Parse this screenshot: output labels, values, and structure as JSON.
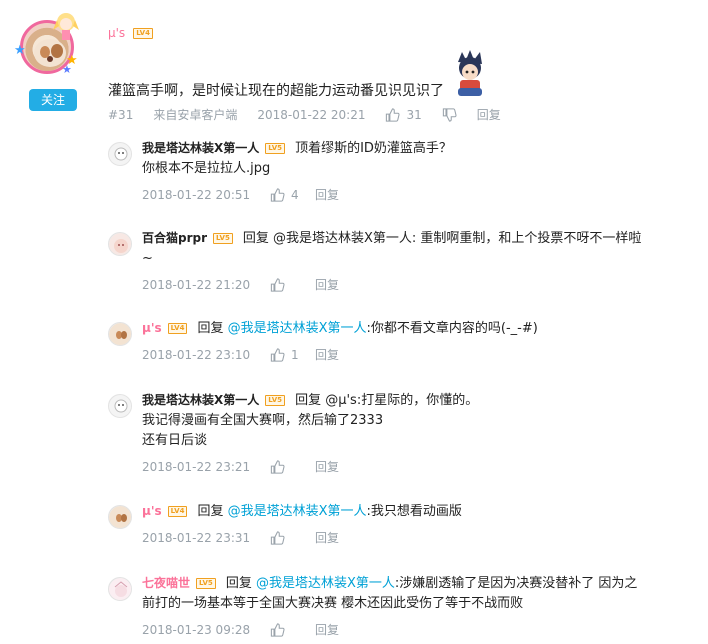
{
  "main": {
    "username": "μ's",
    "level": "LV4",
    "follow_label": "关注",
    "text": "灌篮高手啊，是时候让现在的超能力运动番见识见识了",
    "floor": "#31",
    "client": "来自安卓客户端",
    "time": "2018-01-22 20:21",
    "likes": "31",
    "reply_label": "回复"
  },
  "replies": [
    {
      "name": "我是塔达林装X第一人",
      "level": "LV5",
      "lines": [
        "顶着缪斯的ID奶灌篮高手？",
        "你根本不是拉拉人.jpg"
      ],
      "time": "2018-01-22 20:51",
      "likes": "4",
      "reply_label": "回复"
    },
    {
      "name": "百合猫prpr",
      "level": "LV5",
      "prefix": "回复 @我是塔达林装X第一人: 重制啊重制，和上个投票不呀不一样啦",
      "line2": "~",
      "time": "2018-01-22 21:20",
      "likes": "",
      "reply_label": "回复"
    },
    {
      "name": "μ's",
      "level": "LV4",
      "reply_word": "回复",
      "mention": "@我是塔达林装X第一人",
      "text": ":你都不看文章内容的吗(-_-#)",
      "time": "2018-01-22 23:10",
      "likes": "1",
      "reply_label": "回复"
    },
    {
      "name": "我是塔达林装X第一人",
      "level": "LV5",
      "prefix": "回复 @μ's:打星际的，你懂的。",
      "line2": "我记得漫画有全国大赛啊，然后输了2333",
      "line3": "还有日后谈",
      "time": "2018-01-22 23:21",
      "likes": "",
      "reply_label": "回复"
    },
    {
      "name": "μ's",
      "level": "LV4",
      "reply_word": "回复",
      "mention": "@我是塔达林装X第一人",
      "text": ":我只想看动画版",
      "time": "2018-01-22 23:31",
      "likes": "",
      "reply_label": "回复"
    },
    {
      "name": "七夜喵世",
      "level": "LV5",
      "reply_word": "回复",
      "mention": "@我是塔达林装X第一人",
      "text": ":涉嫌剧透输了是因为决赛没替补了 因为之",
      "line2": "前打的一场基本等于全国大赛决赛 樱木还因此受伤了等于不战而败",
      "time": "2018-01-23 09:28",
      "likes": "",
      "reply_label": "回复"
    }
  ],
  "colors": {
    "accent": "#00a1d6",
    "pink": "#fb7299",
    "meta": "#99a2aa",
    "follow": "#23ade5",
    "level": "#f0a020"
  },
  "icons": [
    "like-icon",
    "dislike-icon",
    "avatar"
  ]
}
